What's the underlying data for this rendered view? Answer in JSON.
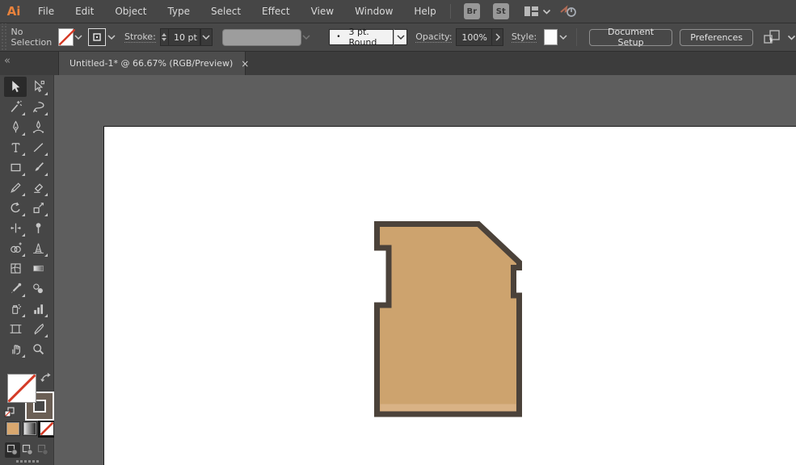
{
  "app": {
    "logo_text": "Ai",
    "logo_color": "#e8823c"
  },
  "menubar": {
    "items": [
      "File",
      "Edit",
      "Object",
      "Type",
      "Select",
      "Effect",
      "View",
      "Window",
      "Help"
    ],
    "badges": [
      {
        "label": "Br"
      },
      {
        "label": "St"
      }
    ],
    "icons": [
      "workspace-switcher-icon",
      "gpu-performance-icon"
    ]
  },
  "controlbar": {
    "selection_status": "No Selection",
    "fill_swatch": "none",
    "stroke_swatch": "stroke-box",
    "stroke_label": "Stroke:",
    "stroke_weight": "10 pt",
    "brush_preset_dot": "•",
    "brush_preset": "3 pt. Round",
    "opacity_label": "Opacity:",
    "opacity_value": "100%",
    "style_label": "Style:",
    "document_setup_label": "Document Setup",
    "preferences_label": "Preferences"
  },
  "tabbar": {
    "collapse_glyph": "«",
    "tab": {
      "title": "Untitled-1* @ 66.67% (RGB/Preview)",
      "close_glyph": "×",
      "active": true
    }
  },
  "toolbar": {
    "tools": [
      {
        "name": "selection",
        "active": true,
        "flyout": false
      },
      {
        "name": "direct-selection",
        "flyout": true
      },
      {
        "name": "magic-wand",
        "flyout": true
      },
      {
        "name": "lasso",
        "flyout": true
      },
      {
        "name": "pen",
        "flyout": true
      },
      {
        "name": "curvature",
        "flyout": false
      },
      {
        "name": "type",
        "flyout": true
      },
      {
        "name": "line-segment",
        "flyout": true
      },
      {
        "name": "rectangle",
        "flyout": true
      },
      {
        "name": "paintbrush",
        "flyout": true
      },
      {
        "name": "shaper",
        "flyout": true
      },
      {
        "name": "eraser",
        "flyout": true
      },
      {
        "name": "rotate",
        "flyout": true
      },
      {
        "name": "scale",
        "flyout": true
      },
      {
        "name": "width",
        "flyout": true
      },
      {
        "name": "puppet-warp",
        "flyout": false
      },
      {
        "name": "shape-builder",
        "flyout": true
      },
      {
        "name": "perspective-grid",
        "flyout": true
      },
      {
        "name": "mesh",
        "flyout": false
      },
      {
        "name": "gradient",
        "flyout": false
      },
      {
        "name": "eyedropper",
        "flyout": true
      },
      {
        "name": "blend",
        "flyout": false
      },
      {
        "name": "symbol-sprayer",
        "flyout": true
      },
      {
        "name": "column-graph",
        "flyout": true
      },
      {
        "name": "artboard",
        "flyout": false
      },
      {
        "name": "slice",
        "flyout": true
      },
      {
        "name": "hand",
        "flyout": true
      },
      {
        "name": "zoom",
        "flyout": false
      }
    ],
    "fill_stroke": {
      "fill": "none",
      "stroke_color": "#6b5f55"
    },
    "mini_swatches": [
      {
        "name": "color",
        "value": "#d9a86f"
      },
      {
        "name": "gradient",
        "value": "linear white-black"
      },
      {
        "name": "none",
        "value": "none",
        "selected": true
      }
    ],
    "drawing_modes": [
      {
        "name": "draw-normal",
        "active": true
      },
      {
        "name": "draw-behind",
        "active": false
      },
      {
        "name": "draw-inside",
        "active": false,
        "disabled": true
      }
    ]
  },
  "canvas": {
    "artboard_color": "#ffffff",
    "pasteboard_color": "#5e5e5e",
    "shape": {
      "description": "SD-card-like polygon with left and right notches and clipped top-right corner",
      "fill": "#cda36e",
      "stroke": "#4b423a",
      "stroke_width_px": 7,
      "bottom_highlight": "#d9b285"
    }
  },
  "colors": {
    "menubar_bg": "#464646",
    "controlbar_bg": "#484848",
    "tabbar_bg": "#3c3c3c",
    "tab_active_bg": "#4d4d4d",
    "toolbar_bg": "#464646",
    "none_slash_red": "#d43a26"
  }
}
